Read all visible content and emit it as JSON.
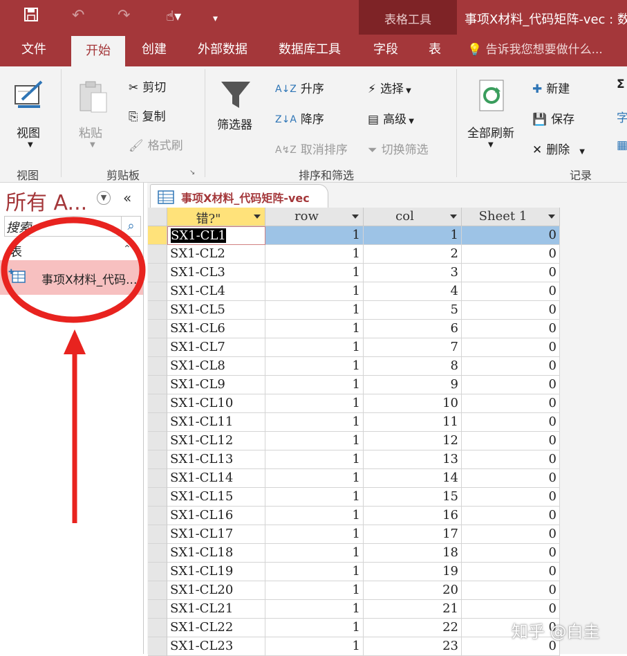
{
  "title_bar": {
    "tool_section": "表格工具",
    "title": "事项X材料_代码矩阵-vec : 数",
    "qat": {
      "save_icon": "save-icon",
      "undo_icon": "undo-icon",
      "redo_icon": "redo-icon",
      "touch_icon": "touch-mode-icon",
      "customize_icon": "customize-qat-icon"
    }
  },
  "tabs": [
    {
      "label": "文件"
    },
    {
      "label": "开始"
    },
    {
      "label": "创建"
    },
    {
      "label": "外部数据"
    },
    {
      "label": "数据库工具"
    },
    {
      "label": "字段"
    },
    {
      "label": "表"
    }
  ],
  "tell_me": "告诉我您想要做什么...",
  "ribbon": {
    "view": {
      "label": "视图",
      "group": "视图"
    },
    "clipboard": {
      "paste": "粘贴",
      "cut": "剪切",
      "copy": "复制",
      "format_painter": "格式刷",
      "group": "剪贴板"
    },
    "sort_filter": {
      "filter": "筛选器",
      "ascending": "升序",
      "descending": "降序",
      "clear_sort": "取消排序",
      "selection": "选择",
      "advanced": "高级",
      "toggle_filter": "切换筛选",
      "group": "排序和筛选"
    },
    "records": {
      "refresh_all": "全部刷新",
      "new": "新建",
      "save": "保存",
      "delete": "删除",
      "group": "记录",
      "extra1": "Σ",
      "extra2": "字"
    }
  },
  "nav_pane": {
    "title": "所有 A...",
    "search_placeholder": "搜索...",
    "search_value": "搜索",
    "category": "表",
    "item": "事项X材料_代码..."
  },
  "datasheet": {
    "tab_title": "事项X材料_代码矩阵-vec",
    "columns": [
      "错?\"",
      "row",
      "col",
      "Sheet 1"
    ],
    "rows": [
      [
        "SX1-CL1",
        "1",
        "1",
        "0"
      ],
      [
        "SX1-CL2",
        "1",
        "2",
        "0"
      ],
      [
        "SX1-CL3",
        "1",
        "3",
        "0"
      ],
      [
        "SX1-CL4",
        "1",
        "4",
        "0"
      ],
      [
        "SX1-CL5",
        "1",
        "5",
        "0"
      ],
      [
        "SX1-CL6",
        "1",
        "6",
        "0"
      ],
      [
        "SX1-CL7",
        "1",
        "7",
        "0"
      ],
      [
        "SX1-CL8",
        "1",
        "8",
        "0"
      ],
      [
        "SX1-CL9",
        "1",
        "9",
        "0"
      ],
      [
        "SX1-CL10",
        "1",
        "10",
        "0"
      ],
      [
        "SX1-CL11",
        "1",
        "11",
        "0"
      ],
      [
        "SX1-CL12",
        "1",
        "12",
        "0"
      ],
      [
        "SX1-CL13",
        "1",
        "13",
        "0"
      ],
      [
        "SX1-CL14",
        "1",
        "14",
        "0"
      ],
      [
        "SX1-CL15",
        "1",
        "15",
        "0"
      ],
      [
        "SX1-CL16",
        "1",
        "16",
        "0"
      ],
      [
        "SX1-CL17",
        "1",
        "17",
        "0"
      ],
      [
        "SX1-CL18",
        "1",
        "18",
        "0"
      ],
      [
        "SX1-CL19",
        "1",
        "19",
        "0"
      ],
      [
        "SX1-CL20",
        "1",
        "20",
        "0"
      ],
      [
        "SX1-CL21",
        "1",
        "21",
        "0"
      ],
      [
        "SX1-CL22",
        "1",
        "22",
        "0"
      ],
      [
        "SX1-CL23",
        "1",
        "23",
        "0"
      ]
    ]
  },
  "watermark": "知乎 @白圭",
  "colors": {
    "accent": "#a4373a",
    "annotation": "#e8231f",
    "selected_row": "#9dc3e6",
    "header_active": "#ffe27a",
    "nav_selected": "#f7c0c0"
  }
}
